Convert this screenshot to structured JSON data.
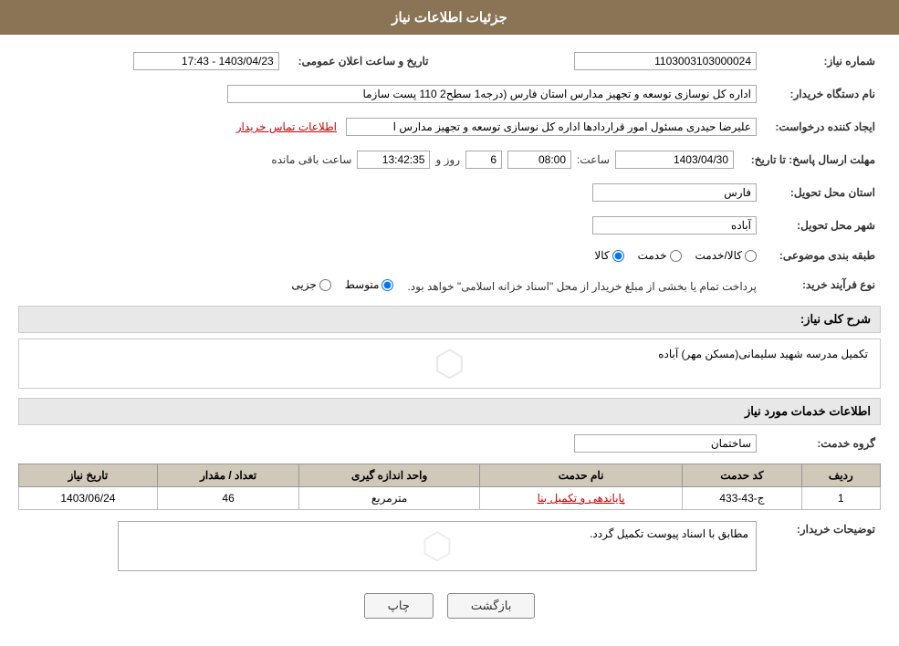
{
  "header": {
    "title": "جزئیات اطلاعات نیاز"
  },
  "fields": {
    "need_number_label": "شماره نیاز:",
    "need_number_value": "1103003103000024",
    "buyer_org_label": "نام دستگاه خریدار:",
    "buyer_org_value": "اداره کل نوسازی   توسعه و تجهیز مدارس استان فارس (درجه1  سطح2  110 پست سازما",
    "requester_label": "ایجاد کننده درخواست:",
    "requester_value": "علیرضا حیدری مسئول امور قراردادها اداره کل نوسازی   توسعه و تجهیز مدارس ا",
    "contact_link": "اطلاعات تماس خریدار",
    "reply_deadline_label": "مهلت ارسال پاسخ: تا تاریخ:",
    "date_value": "1403/04/30",
    "time_label": "ساعت:",
    "time_value": "08:00",
    "day_label": "روز و",
    "day_value": "6",
    "remaining_label": "ساعت باقی مانده",
    "countdown_value": "13:42:35",
    "province_label": "استان محل تحویل:",
    "province_value": "فارس",
    "city_label": "شهر محل تحویل:",
    "city_value": "آباده",
    "category_label": "طبقه بندی موضوعی:",
    "radio_options": [
      "کالا",
      "خدمت",
      "کالا/خدمت"
    ],
    "selected_category": "کالا",
    "purchase_type_label": "نوع فرآیند خرید:",
    "purchase_options": [
      "جزیی",
      "متوسط"
    ],
    "selected_purchase": "متوسط",
    "purchase_notice": "پرداخت تمام یا بخشی از مبلغ خریدار از محل \"اسناد خزانه اسلامی\" خواهد بود.",
    "general_desc_label": "شرح کلی نیاز:",
    "general_desc_value": "تکمیل مدرسه شهید سلیمانی(مسکن مهر) آباده",
    "services_section_label": "اطلاعات خدمات مورد نیاز",
    "service_group_label": "گروه خدمت:",
    "service_group_value": "ساختمان",
    "table": {
      "headers": [
        "ردیف",
        "کد حدمت",
        "نام حدمت",
        "واحد اندازه گیری",
        "تعداد / مقدار",
        "تاریخ نیاز"
      ],
      "rows": [
        {
          "row": "1",
          "code": "ج-43-433",
          "name": "پایاندهی و تکمیل بنا",
          "unit": "مترمربع",
          "quantity": "46",
          "date": "1403/06/24"
        }
      ]
    },
    "buyer_notes_label": "توضیحات خریدار:",
    "buyer_notes_value": "مطابق با اسناد پیوست تکمیل گردد.",
    "announcement_date_label": "تاریخ و ساعت اعلان عمومی:",
    "announcement_date_value": "1403/04/23 - 17:43"
  },
  "buttons": {
    "print_label": "چاپ",
    "back_label": "بازگشت"
  }
}
